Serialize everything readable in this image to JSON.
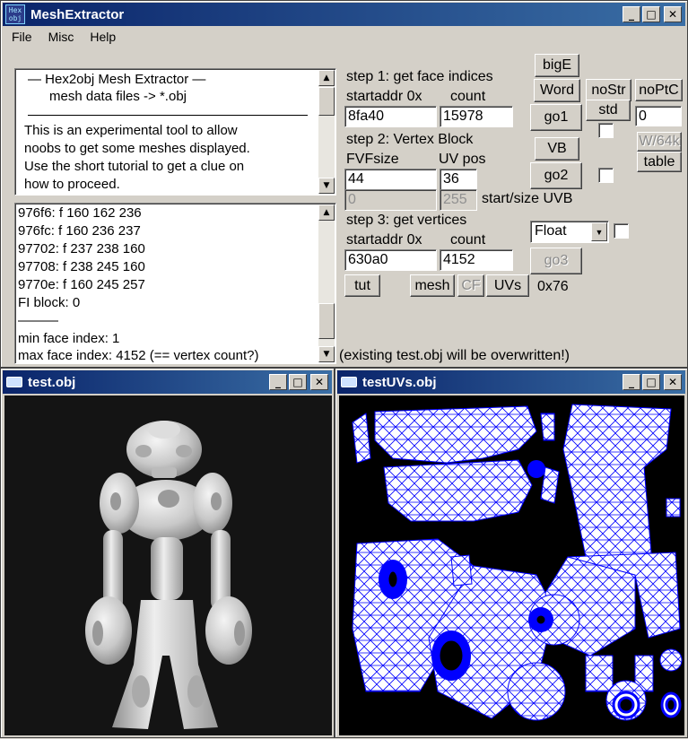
{
  "main_window": {
    "title": "MeshExtractor",
    "icon_text": [
      "Hex",
      "obj"
    ],
    "menu": [
      "File",
      "Misc",
      "Help"
    ]
  },
  "info_box": {
    "lines": [
      "—   Hex2obj Mesh Extractor   —",
      "mesh data files -> *.obj",
      "This is an experimental tool to allow",
      "noobs to get some meshes displayed.",
      "Use the short tutorial to get a clue on",
      "how to proceed."
    ]
  },
  "log_box": {
    "lines": [
      "976f6: f  160 162 236",
      "976fc: f  160 236 237",
      "97702: f  237 238 160",
      "97708: f  238 245 160",
      "9770e: f  160 245 257",
      "FI block: 0",
      "———",
      "min face index: 1",
      "max face index: 4152 (== vertex count?)"
    ]
  },
  "step1": {
    "title": "step 1: get face indices",
    "startaddr_label": "startaddr 0x",
    "count_label": "count",
    "startaddr": "8fa40",
    "count": "15978"
  },
  "step2": {
    "title": "step 2: Vertex Block",
    "fvf_label": "FVFsize",
    "uvpos_label": "UV pos",
    "fvf": "44",
    "uvpos": "36",
    "uvb_start": "0",
    "uvb_size": "255",
    "uvb_label": "start/size UVB"
  },
  "step3": {
    "title": "step 3: get vertices",
    "startaddr_label": "startaddr 0x",
    "count_label": "count",
    "startaddr": "630a0",
    "count": "4152",
    "format": "Float"
  },
  "buttons": {
    "bigE": "bigE",
    "word": "Word",
    "nostr": "noStr",
    "noptc": "noPtC",
    "go1": "go1",
    "std": "std",
    "vb": "VB",
    "w64k": "W/64k",
    "table": "table",
    "go2": "go2",
    "go3": "go3",
    "tut": "tut",
    "mesh": "mesh",
    "cf": "CF",
    "uvs": "UVs"
  },
  "misc": {
    "noptc_value": "0",
    "hex_readout": "0x76",
    "status": "(existing test.obj will be overwritten!)"
  },
  "viewer_mesh": {
    "title": "test.obj"
  },
  "viewer_uv": {
    "title": "testUVs.obj"
  },
  "colors": {
    "titlebar": "#0a246a",
    "uv_lines": "#0000ff",
    "mesh": "#d8d8d8"
  }
}
